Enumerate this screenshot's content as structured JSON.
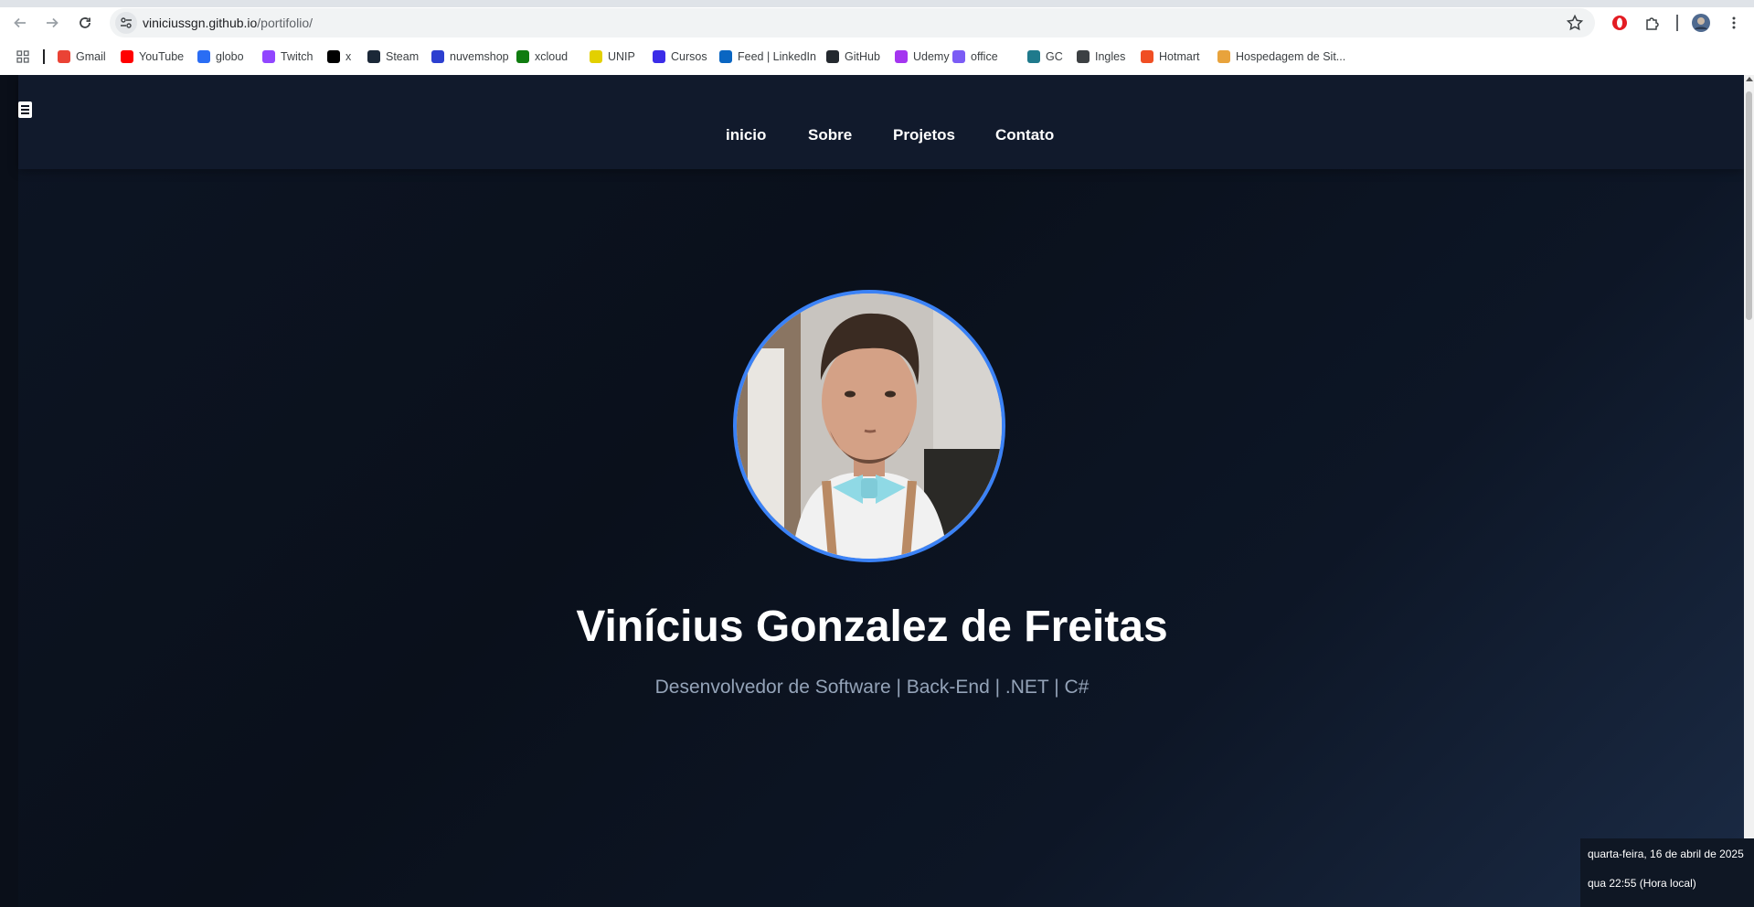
{
  "browser": {
    "url_host": "viniciussgn.github.io",
    "url_path": "/portifolio/",
    "bookmarks": [
      {
        "label": "Gmail",
        "icon": "gmail-icon",
        "color": "#ea4335"
      },
      {
        "label": "YouTube",
        "icon": "youtube-icon",
        "color": "#ff0000"
      },
      {
        "label": "globo",
        "icon": "globo-icon",
        "color": "#2a6df4"
      },
      {
        "label": "Twitch",
        "icon": "twitch-icon",
        "color": "#9146ff"
      },
      {
        "label": "x",
        "icon": "x-icon",
        "color": "#000000"
      },
      {
        "label": "Steam",
        "icon": "steam-icon",
        "color": "#1b2838"
      },
      {
        "label": "nuvemshop",
        "icon": "nuvemshop-icon",
        "color": "#2c3fd0"
      },
      {
        "label": "xcloud",
        "icon": "xbox-icon",
        "color": "#107c10"
      },
      {
        "label": "UNIP",
        "icon": "unip-icon",
        "color": "#e3d000"
      },
      {
        "label": "Cursos",
        "icon": "cursos-icon",
        "color": "#3b2ce8"
      },
      {
        "label": "Feed | LinkedIn",
        "icon": "linkedin-icon",
        "color": "#0a66c2"
      },
      {
        "label": "GitHub",
        "icon": "github-icon",
        "color": "#24292f"
      },
      {
        "label": "Udemy",
        "icon": "udemy-icon",
        "color": "#a435f0"
      },
      {
        "label": "office",
        "icon": "office-icon",
        "color": "#7b5cf5"
      },
      {
        "label": "GC",
        "icon": "gc-icon",
        "color": "#1f7a8c"
      },
      {
        "label": "Ingles",
        "icon": "globe-icon",
        "color": "#3c4043"
      },
      {
        "label": "Hotmart",
        "icon": "hotmart-icon",
        "color": "#f04e23"
      },
      {
        "label": "Hospedagem de Sit...",
        "icon": "hosting-icon",
        "color": "#e8a33c"
      }
    ]
  },
  "site": {
    "nav": [
      "inicio",
      "Sobre",
      "Projetos",
      "Contato"
    ],
    "name": "Vinícius Gonzalez de Freitas",
    "subtitle": "Desenvolvedor de Software | Back-End | .NET | C#",
    "accent": "#3b82f6"
  },
  "clock": {
    "date": "quarta-feira, 16 de abril de 2025",
    "time": "qua 22:55 (Hora local)"
  }
}
